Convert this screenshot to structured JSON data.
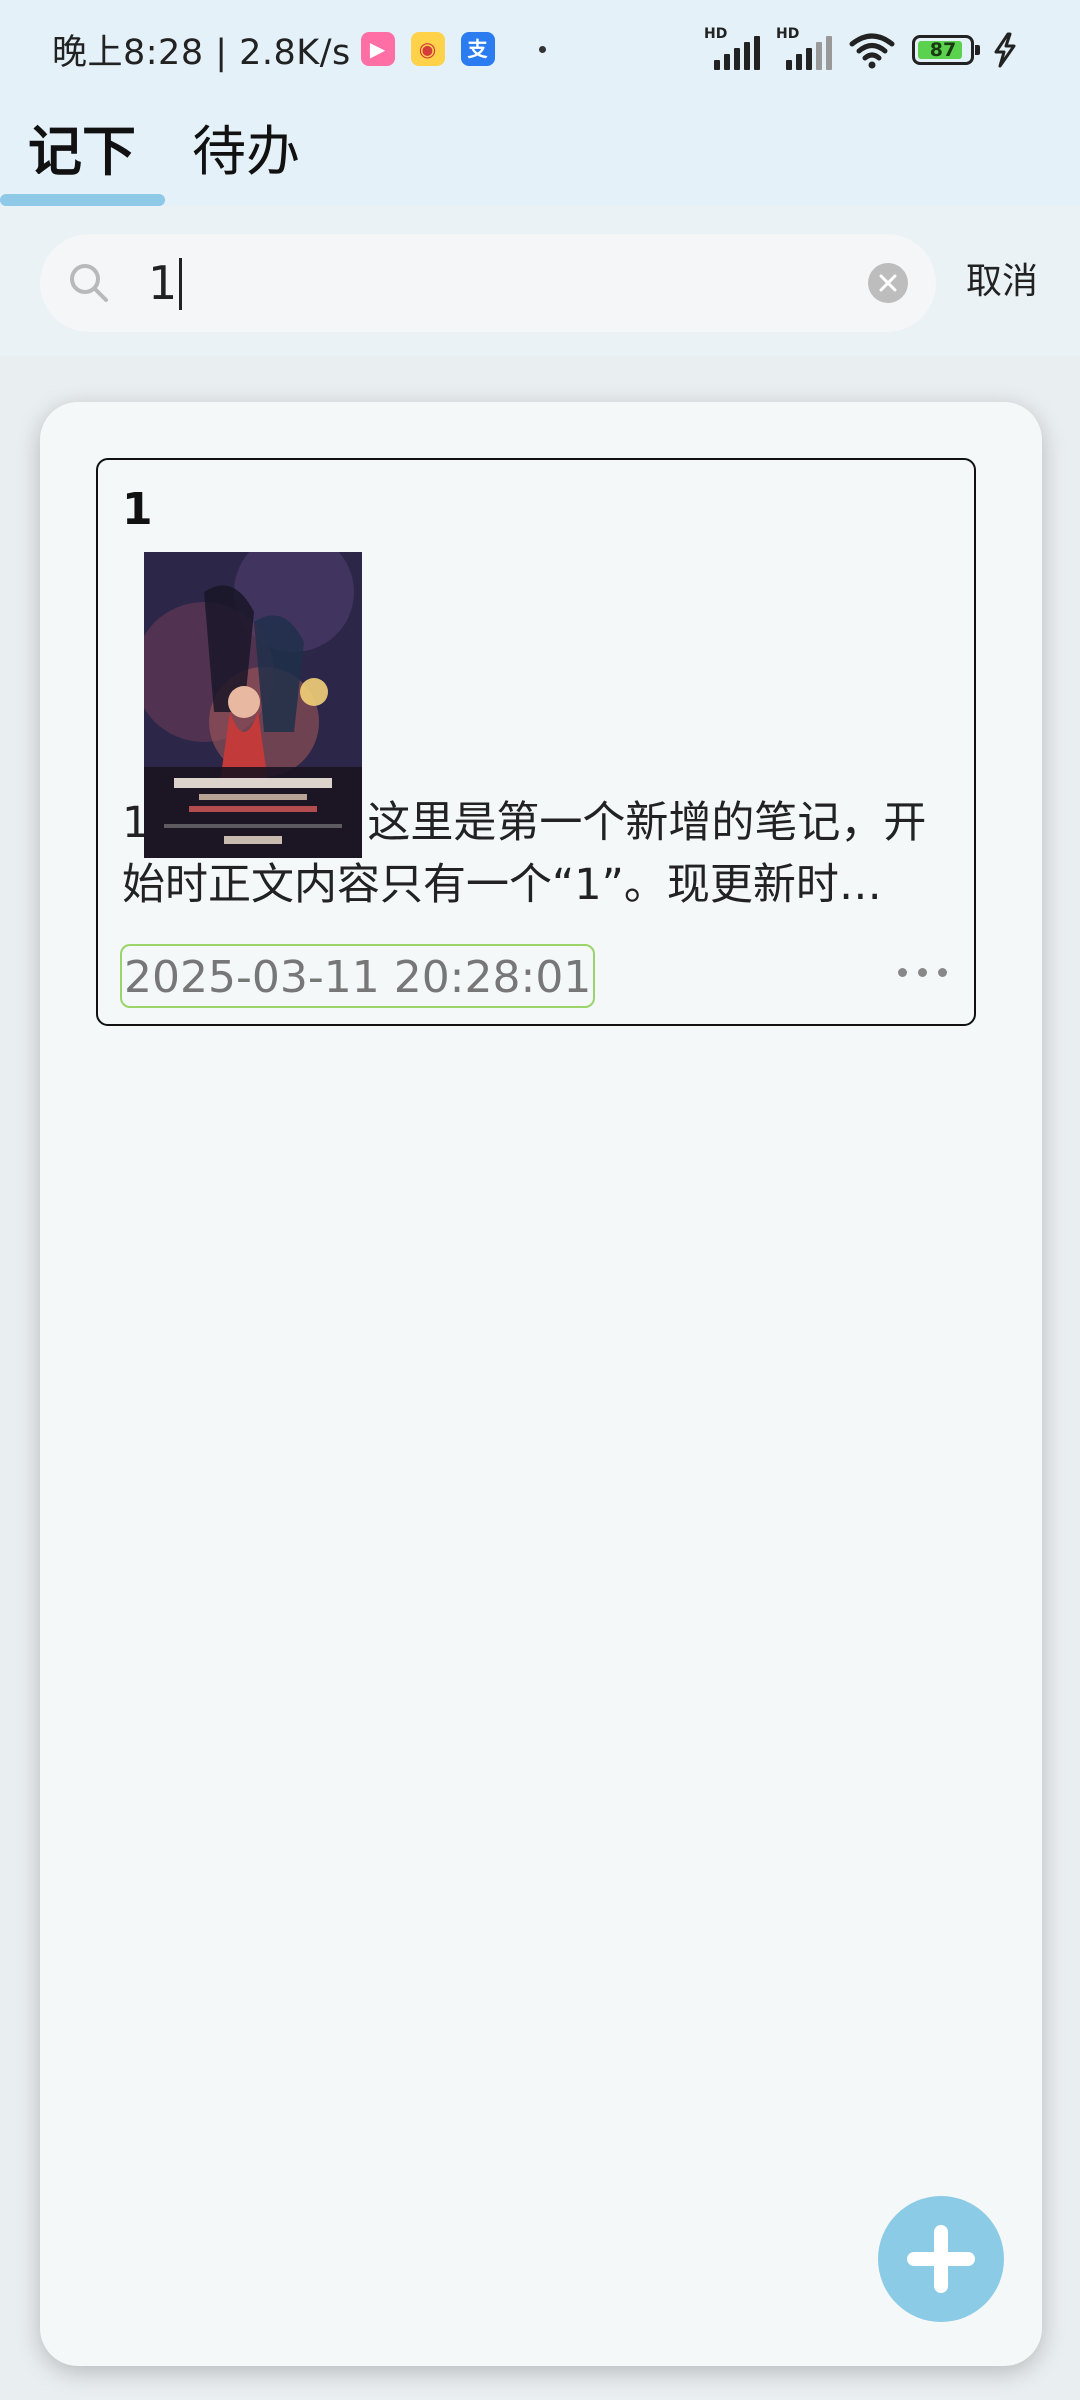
{
  "status_bar": {
    "time_speed": "晚上8:28 | 2.8K/s",
    "app_icons": [
      "bilibili-icon",
      "weibo-icon",
      "alipay-icon"
    ],
    "alipay_glyph": "支",
    "signal_label_1": "HD",
    "signal_label_2": "HD",
    "battery_level": "87",
    "battery_fraction": 0.87
  },
  "tabs": [
    {
      "label": "记下",
      "active": true
    },
    {
      "label": "待办",
      "active": false
    }
  ],
  "search": {
    "value": "1",
    "cancel_label": "取消"
  },
  "notes": [
    {
      "title": "1",
      "body_line1_prefix": "1",
      "body_line1_suffix": "这里是第一个新增的笔记，开",
      "body_line2": "始时正文内容只有一个“1”。现更新时…",
      "date": "2025-03-11 20:28:01"
    }
  ],
  "colors": {
    "header_bg": "#e4f1f8",
    "tab_indicator": "#8ec9e8",
    "fab": "#8bcbe6",
    "date_border": "#9bd46a",
    "battery_fill": "#5bd24d"
  }
}
